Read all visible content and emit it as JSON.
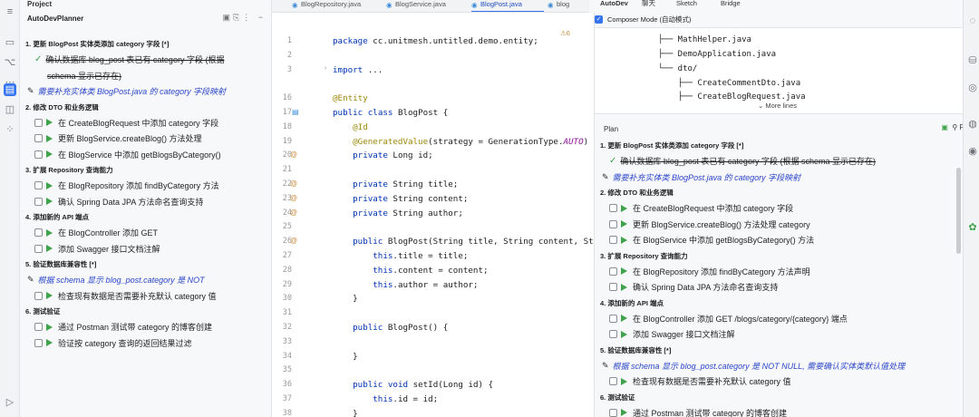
{
  "left_panel": {
    "header": "Project",
    "title": "AutoDevPlanner",
    "sections": [
      {
        "label": "1. 更新 BlogPost 实体类添加 category 字段 [*]",
        "items": [
          {
            "kind": "done",
            "text": "确认数据库 blog_post 表已有 category 字段 (根据"
          },
          {
            "kind": "cont",
            "text": "schema 显示已存在)"
          },
          {
            "kind": "note",
            "text": "需要补充实体类 BlogPost.java 的 category 字段映射"
          }
        ]
      },
      {
        "label": "2. 修改 DTO 和业务逻辑",
        "items": [
          {
            "kind": "task",
            "text": "在 CreateBlogRequest 中添加 category 字段"
          },
          {
            "kind": "task",
            "text": "更新 BlogService.createBlog() 方法处理"
          },
          {
            "kind": "task",
            "text": "在 BlogService 中添加 getBlogsByCategory()"
          }
        ]
      },
      {
        "label": "3. 扩展 Repository 查询能力",
        "items": [
          {
            "kind": "task",
            "text": "在 BlogRepository 添加 findByCategory 方法"
          },
          {
            "kind": "task",
            "text": "确认 Spring Data JPA 方法命名查询支持"
          }
        ]
      },
      {
        "label": "4. 添加新的 API 端点",
        "items": [
          {
            "kind": "task",
            "text": "在 BlogController 添加 GET"
          },
          {
            "kind": "task",
            "text": "添加 Swagger 接口文档注解"
          }
        ]
      },
      {
        "label": "5. 验证数据库兼容性 [*]",
        "items": [
          {
            "kind": "note",
            "text": "根据 schema 显示 blog_post.category 是 NOT"
          },
          {
            "kind": "task",
            "text": "检查现有数据是否需要补充默认 category 值"
          }
        ]
      },
      {
        "label": "6. 测试验证",
        "items": [
          {
            "kind": "task",
            "text": "通过 Postman 测试带 category 的博客创建"
          },
          {
            "kind": "task",
            "text": "验证按 category 查询的返回结果过滤"
          }
        ]
      }
    ]
  },
  "editor": {
    "tabs": [
      "BlogRepository.java",
      "BlogService.java",
      "BlogPost.java",
      "blog"
    ],
    "active_tab": "BlogPost.java",
    "warning": "⚠6",
    "code": [
      {
        "n": "1",
        "t": "package cc.unitmesh.untitled.demo.entity;"
      },
      {
        "n": "2",
        "t": ""
      },
      {
        "n": "3",
        "t": "import ..."
      },
      {
        "n": "",
        "t": ""
      },
      {
        "n": "16",
        "t": "@Entity"
      },
      {
        "n": "17",
        "t": "public class BlogPost {"
      },
      {
        "n": "18",
        "t": "    @Id"
      },
      {
        "n": "19",
        "t": "    @GeneratedValue(strategy = GenerationType.AUTO)"
      },
      {
        "n": "20",
        "t": "    private Long id;"
      },
      {
        "n": "21",
        "t": ""
      },
      {
        "n": "22",
        "t": "    private String title;"
      },
      {
        "n": "23",
        "t": "    private String content;"
      },
      {
        "n": "24",
        "t": "    private String author;"
      },
      {
        "n": "25",
        "t": ""
      },
      {
        "n": "26",
        "t": "    public BlogPost(String title, String content, Str"
      },
      {
        "n": "27",
        "t": "        this.title = title;"
      },
      {
        "n": "28",
        "t": "        this.content = content;"
      },
      {
        "n": "29",
        "t": "        this.author = author;"
      },
      {
        "n": "30",
        "t": "    }"
      },
      {
        "n": "31",
        "t": ""
      },
      {
        "n": "32",
        "t": "    public BlogPost() {"
      },
      {
        "n": "33",
        "t": ""
      },
      {
        "n": "34",
        "t": "    }"
      },
      {
        "n": "35",
        "t": ""
      },
      {
        "n": "36",
        "t": "    public void setId(Long id) {"
      },
      {
        "n": "37",
        "t": "        this.id = id;"
      },
      {
        "n": "38",
        "t": "    }"
      }
    ]
  },
  "right_panel": {
    "tabs": [
      "AutoDev",
      "聊天",
      "Sketch",
      "Bridge"
    ],
    "composer_label": "Composer Mode (自动模式)",
    "tree": [
      "├── MathHelper.java",
      "├── DemoApplication.java",
      "└── dto/",
      "    ├── CreateCommentDto.java",
      "    ├── CreateBlogRequest.java"
    ],
    "more_lines": "More lines",
    "plan_label": "Plan",
    "pin_label": "Pin",
    "sections": [
      {
        "label": "1. 更新 BlogPost 实体类添加 category 字段 [*]",
        "items": [
          {
            "kind": "done",
            "text": "确认数据库 blog_post 表已有 category 字段 (根据 schema 显示已存在)"
          },
          {
            "kind": "note",
            "text": "需要补充实体类 BlogPost.java 的 category 字段映射"
          }
        ]
      },
      {
        "label": "2. 修改 DTO 和业务逻辑",
        "items": [
          {
            "kind": "task",
            "text": "在 CreateBlogRequest 中添加 category 字段"
          },
          {
            "kind": "task",
            "text": "更新 BlogService.createBlog() 方法处理 category"
          },
          {
            "kind": "task",
            "text": "在 BlogService 中添加 getBlogsByCategory() 方法"
          }
        ]
      },
      {
        "label": "3. 扩展 Repository 查询能力",
        "items": [
          {
            "kind": "task",
            "text": "在 BlogRepository 添加 findByCategory 方法声明"
          },
          {
            "kind": "task",
            "text": "确认 Spring Data JPA 方法命名查询支持"
          }
        ]
      },
      {
        "label": "4. 添加新的 API 端点",
        "items": [
          {
            "kind": "task",
            "text": "在 BlogController 添加 GET /blogs/category/{category} 端点"
          },
          {
            "kind": "task",
            "text": "添加 Swagger 接口文档注解"
          }
        ]
      },
      {
        "label": "5. 验证数据库兼容性 [*]",
        "items": [
          {
            "kind": "note",
            "text": "根据 schema 显示 blog_post.category 是 NOT NULL, 需要确认实体类默认值处理"
          },
          {
            "kind": "task",
            "text": "检查现有数据是否需要补充默认 category 值"
          }
        ]
      },
      {
        "label": "6. 测试验证",
        "items": [
          {
            "kind": "task",
            "text": "通过 Postman 测试带 category 的博客创建"
          }
        ]
      }
    ]
  }
}
